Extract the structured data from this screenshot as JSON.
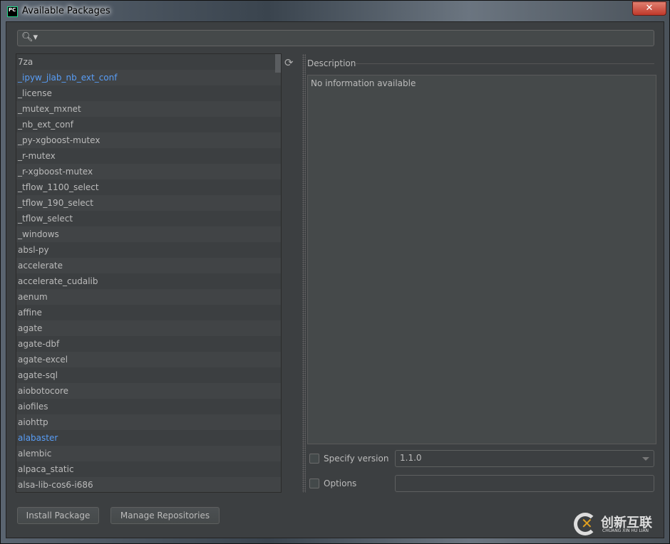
{
  "window": {
    "title": "Available Packages",
    "close": "✕"
  },
  "search": {
    "value": "",
    "icon": "search-icon"
  },
  "packages": [
    {
      "name": "7za",
      "highlighted": false
    },
    {
      "name": "_ipyw_jlab_nb_ext_conf",
      "highlighted": true
    },
    {
      "name": "_license",
      "highlighted": false
    },
    {
      "name": "_mutex_mxnet",
      "highlighted": false
    },
    {
      "name": "_nb_ext_conf",
      "highlighted": false
    },
    {
      "name": "_py-xgboost-mutex",
      "highlighted": false
    },
    {
      "name": "_r-mutex",
      "highlighted": false
    },
    {
      "name": "_r-xgboost-mutex",
      "highlighted": false
    },
    {
      "name": "_tflow_1100_select",
      "highlighted": false
    },
    {
      "name": "_tflow_190_select",
      "highlighted": false
    },
    {
      "name": "_tflow_select",
      "highlighted": false
    },
    {
      "name": "_windows",
      "highlighted": false
    },
    {
      "name": "absl-py",
      "highlighted": false
    },
    {
      "name": "accelerate",
      "highlighted": false
    },
    {
      "name": "accelerate_cudalib",
      "highlighted": false
    },
    {
      "name": "aenum",
      "highlighted": false
    },
    {
      "name": "affine",
      "highlighted": false
    },
    {
      "name": "agate",
      "highlighted": false
    },
    {
      "name": "agate-dbf",
      "highlighted": false
    },
    {
      "name": "agate-excel",
      "highlighted": false
    },
    {
      "name": "agate-sql",
      "highlighted": false
    },
    {
      "name": "aiobotocore",
      "highlighted": false
    },
    {
      "name": "aiofiles",
      "highlighted": false
    },
    {
      "name": "aiohttp",
      "highlighted": false
    },
    {
      "name": "alabaster",
      "highlighted": true
    },
    {
      "name": "alembic",
      "highlighted": false
    },
    {
      "name": "alpaca_static",
      "highlighted": false
    },
    {
      "name": "alsa-lib-cos6-i686",
      "highlighted": false
    }
  ],
  "description": {
    "label": "Description",
    "text": "No information available"
  },
  "specify_version": {
    "label": "Specify version",
    "checked": false,
    "value": "1.1.0"
  },
  "options": {
    "label": "Options",
    "checked": false,
    "value": ""
  },
  "buttons": {
    "install": "Install Package",
    "manage": "Manage Repositories"
  },
  "watermark": {
    "cn": "创新互联",
    "en": "CHUANG XIN HU LIAN"
  },
  "colors": {
    "background": "#3c3f41",
    "link": "#589df6"
  }
}
